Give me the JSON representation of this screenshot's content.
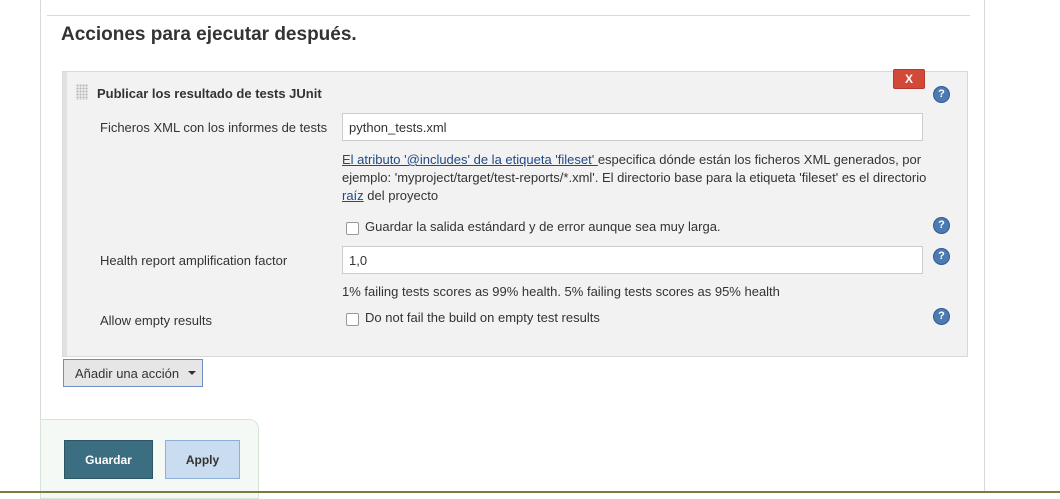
{
  "section": {
    "title": "Acciones para ejecutar después."
  },
  "publisher": {
    "title": "Publicar los resultado de tests JUnit",
    "delete_label": "X",
    "xml_files": {
      "label": "Ficheros XML con los informes de tests",
      "value": "python_tests.xml",
      "description": {
        "link": "El atributo '@includes' de la etiqueta 'fileset' ",
        "text1": "especifica dónde están los ficheros XML generados, por ejemplo: 'myproject/target/test-reports/*.xml'. El directorio base para la etiqueta 'fileset' es el directorio ",
        "link2": "raíz",
        "text2": " del proyecto"
      }
    },
    "keep_output": {
      "label": "Guardar la salida estándard y de error aunque sea muy larga.",
      "checked": false
    },
    "health_factor": {
      "label": "Health report amplification factor",
      "value": "1,0",
      "description": "1% failing tests scores as 99% health. 5% failing tests scores as 95% health"
    },
    "allow_empty": {
      "label": "Allow empty results",
      "checkbox_label": "Do not fail the build on empty test results",
      "checked": false
    }
  },
  "add_action": {
    "label": "Añadir una acción"
  },
  "buttons": {
    "save": "Guardar",
    "apply": "Apply"
  },
  "icons": {
    "help": "help-icon",
    "drag": "drag-handle-icon",
    "caret": "caret-down-icon"
  },
  "colors": {
    "delete": "#d24939",
    "help": "#4c7ab1",
    "save": "#3a6e80",
    "apply": "#c9dcf0",
    "link": "#204a87"
  }
}
